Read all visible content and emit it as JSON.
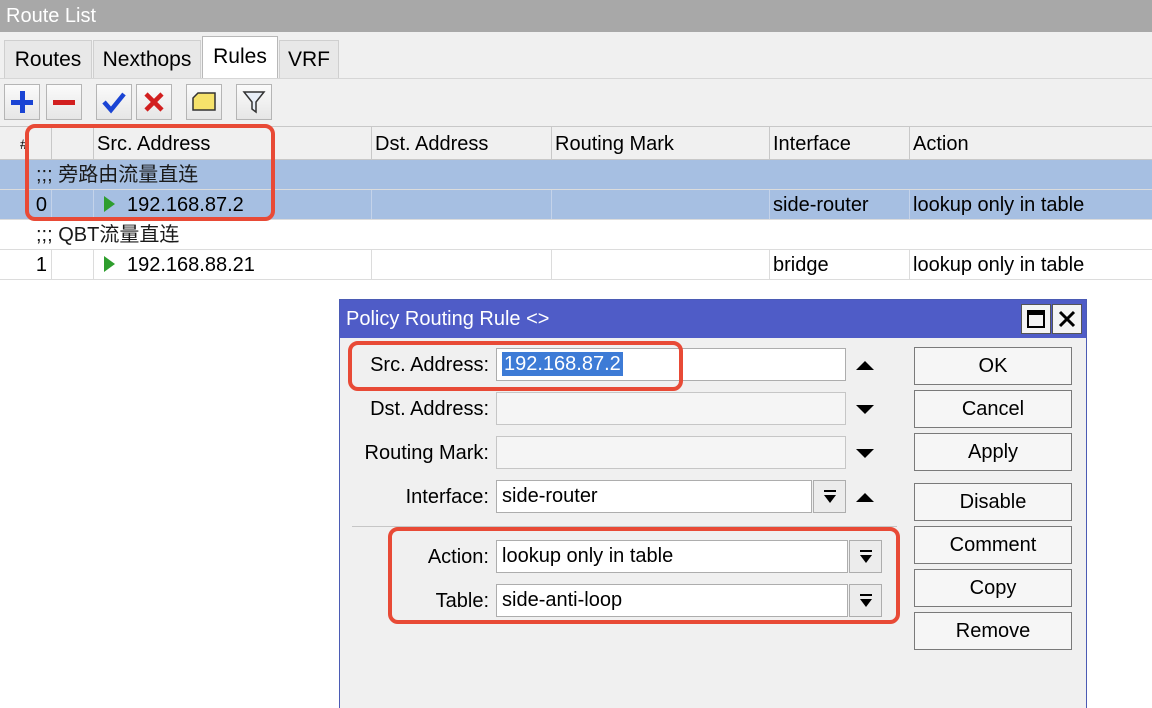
{
  "window": {
    "title": "Route List"
  },
  "tabs": [
    {
      "label": "Routes"
    },
    {
      "label": "Nexthops"
    },
    {
      "label": "Rules"
    },
    {
      "label": "VRF"
    }
  ],
  "toolbar": [
    "add-icon",
    "remove-icon",
    "enable-icon",
    "disable-icon",
    "comment-icon",
    "filter-icon"
  ],
  "columns": {
    "num": "#",
    "src": "Src. Address",
    "dst": "Dst. Address",
    "mark": "Routing Mark",
    "iface": "Interface",
    "action": "Action"
  },
  "rows": [
    {
      "comment": ";;; 旁路由流量直连",
      "num": "0",
      "src": "192.168.87.2",
      "dst": "",
      "mark": "",
      "iface": "side-router",
      "action": "lookup only in table",
      "selected": true
    },
    {
      "comment": ";;; QBT流量直连",
      "num": "1",
      "src": "192.168.88.21",
      "dst": "",
      "mark": "",
      "iface": "bridge",
      "action": "lookup only in table",
      "selected": false
    }
  ],
  "dialog": {
    "title": "Policy Routing Rule <>",
    "fields": {
      "src_label": "Src. Address:",
      "src_value": "192.168.87.2",
      "dst_label": "Dst. Address:",
      "dst_value": "",
      "mark_label": "Routing Mark:",
      "mark_value": "",
      "iface_label": "Interface:",
      "iface_value": "side-router",
      "action_label": "Action:",
      "action_value": "lookup only in table",
      "table_label": "Table:",
      "table_value": "side-anti-loop"
    },
    "buttons": {
      "ok": "OK",
      "cancel": "Cancel",
      "apply": "Apply",
      "disable": "Disable",
      "comment": "Comment",
      "copy": "Copy",
      "remove": "Remove"
    }
  },
  "colors": {
    "selection": "#a6bfe2",
    "dialog_title": "#4f5cc7",
    "highlight": "#e84a36",
    "play": "#2e9e2e"
  }
}
